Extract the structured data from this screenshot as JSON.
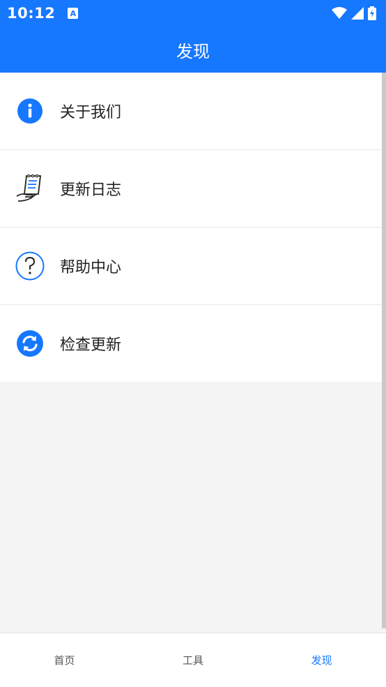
{
  "status_bar": {
    "time": "10:12",
    "notification_icon": "a-letter-icon",
    "wifi_icon": "wifi-icon",
    "signal_icon": "signal-icon",
    "battery_icon": "battery-charging-icon"
  },
  "header": {
    "title": "发现"
  },
  "menu": {
    "items": [
      {
        "label": "关于我们",
        "icon": "info-icon"
      },
      {
        "label": "更新日志",
        "icon": "changelog-icon"
      },
      {
        "label": "帮助中心",
        "icon": "help-icon"
      },
      {
        "label": "检查更新",
        "icon": "refresh-icon"
      }
    ]
  },
  "tabs": [
    {
      "label": "首页"
    },
    {
      "label": "工具"
    },
    {
      "label": "发现",
      "active": true
    }
  ],
  "colors": {
    "primary": "#1677ff",
    "background": "#f4f4f4",
    "text": "#222222"
  }
}
